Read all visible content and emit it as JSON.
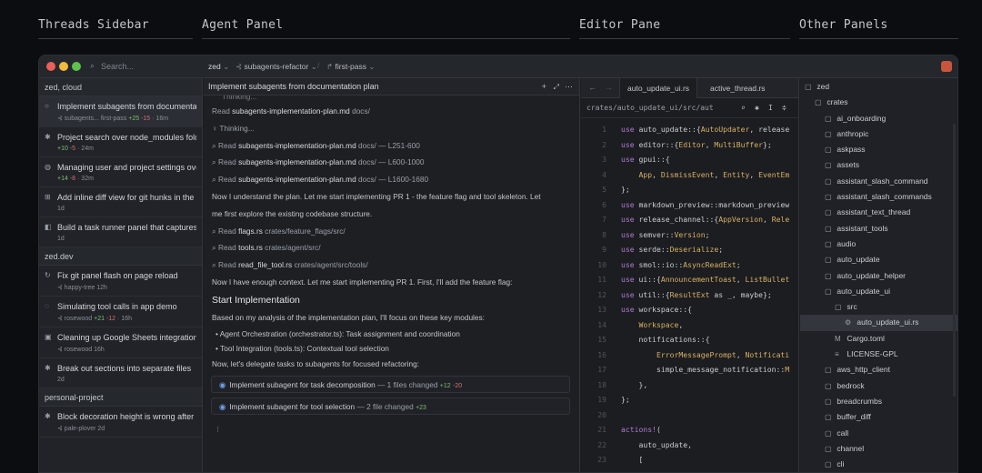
{
  "sections": [
    "Threads Sidebar",
    "Agent Panel",
    "Editor Pane",
    "Other Panels"
  ],
  "titlebar": {
    "search_placeholder": "Search...",
    "project": "zed",
    "branch": "subagents-refactor",
    "pass": "first-pass"
  },
  "sidebar": {
    "groups": [
      {
        "name": "zed, cloud",
        "threads": [
          {
            "icon": "○",
            "title": "Implement subagents from documentation plan",
            "meta": "⊰ subagents... first-pass",
            "plus": "+25",
            "minus": "-15",
            "age": "16m",
            "active": true
          },
          {
            "icon": "✱",
            "title": "Project search over node_modules folder",
            "meta": "",
            "plus": "+10",
            "minus": "-5",
            "age": "24m"
          },
          {
            "icon": "◍",
            "title": "Managing user and project settings overview",
            "meta": "",
            "plus": "+14",
            "minus": "-8",
            "age": "32m"
          },
          {
            "icon": "⊞",
            "title": "Add inline diff view for git hunks in the gutter",
            "meta": "",
            "plus": "",
            "minus": "",
            "age": "1d"
          },
          {
            "icon": "◧",
            "title": "Build a task runner panel that captures output",
            "meta": "",
            "plus": "",
            "minus": "",
            "age": "1d"
          }
        ]
      },
      {
        "name": "zed.dev",
        "threads": [
          {
            "icon": "↻",
            "title": "Fix git panel flash on page reload",
            "meta": "⊰ happy-tree",
            "plus": "",
            "minus": "",
            "age": "12h"
          },
          {
            "icon": "◌",
            "title": "Simulating tool calls in app demo",
            "meta": "⊰ rosewood",
            "plus": "+21",
            "minus": "-12",
            "age": "16h"
          },
          {
            "icon": "▣",
            "title": "Cleaning up Google Sheets integration",
            "meta": "⊰ rosewood",
            "plus": "",
            "minus": "",
            "age": "16h"
          },
          {
            "icon": "✱",
            "title": "Break out sections into separate files",
            "meta": "",
            "plus": "",
            "minus": "",
            "age": "2d"
          }
        ]
      },
      {
        "name": "personal-project",
        "threads": [
          {
            "icon": "✱",
            "title": "Block decoration height is wrong after resize",
            "meta": "⊰ pale-plover",
            "plus": "",
            "minus": "",
            "age": "2d"
          }
        ]
      }
    ]
  },
  "agent": {
    "title": "Implement subagents from documentation plan",
    "lines": [
      {
        "k": "cut",
        "text": "Thinking..."
      },
      {
        "k": "read",
        "pre": "Read",
        "file": "subagents-implementation-plan.md",
        "path": "docs/"
      },
      {
        "k": "think",
        "text": "Thinking..."
      },
      {
        "k": "read",
        "pre": "Read",
        "file": "subagents-implementation-plan.md",
        "path": "docs/ — L251-600",
        "search": true
      },
      {
        "k": "read",
        "pre": "Read",
        "file": "subagents-implementation-plan.md",
        "path": "docs/ — L600-1000",
        "search": true
      },
      {
        "k": "read",
        "pre": "Read",
        "file": "subagents-implementation-plan.md",
        "path": "docs/ — L1600-1680",
        "search": true
      },
      {
        "k": "p",
        "text": "Now I understand the plan. Let me start implementing PR 1 - the feature flag and tool skeleton. Let"
      },
      {
        "k": "p",
        "text": "me first explore the existing codebase structure."
      },
      {
        "k": "read",
        "pre": "Read",
        "file": "flags.rs",
        "path": "crates/feature_flags/src/",
        "search": true
      },
      {
        "k": "read",
        "pre": "Read",
        "file": "tools.rs",
        "path": "crates/agent/src/",
        "search": true
      },
      {
        "k": "read",
        "pre": "Read",
        "file": "read_file_tool.rs",
        "path": "crates/agent/src/tools/",
        "search": true
      },
      {
        "k": "p",
        "text": "Now I have enough context. Let me start implementing PR 1. First, I'll add the feature flag:"
      },
      {
        "k": "h",
        "text": "Start Implementation"
      },
      {
        "k": "p",
        "text": "Based on my analysis of the implementation plan, I'll focus on these key modules:"
      },
      {
        "k": "b",
        "text": "Agent Orchestration (orchestrator.ts): Task assignment and coordination"
      },
      {
        "k": "b",
        "text": "Tool Integration (tools.ts): Contextual tool selection"
      },
      {
        "k": "p",
        "text": "Now, let's delegate tasks to subagents for focused refactoring:"
      }
    ],
    "subagents": [
      {
        "text": "Implement subagent for task decomposition",
        "changes": "— 1 files changed",
        "plus": "+12",
        "minus": "-20"
      },
      {
        "text": "Implement subagent for tool selection",
        "changes": "— 2 file changed",
        "plus": "+23",
        "minus": ""
      }
    ]
  },
  "editor": {
    "tabs": [
      "auto_update_ui.rs",
      "active_thread.rs"
    ],
    "breadcrumb": "crates/auto_update_ui/src/aut",
    "code": [
      [
        [
          "kw",
          "use "
        ],
        [
          "pl",
          "auto_update::{"
        ],
        [
          "ty",
          "AutoUpdater"
        ],
        [
          "pl",
          ", release"
        ]
      ],
      [
        [
          "kw",
          "use "
        ],
        [
          "pl",
          "editor::{"
        ],
        [
          "ty",
          "Editor"
        ],
        [
          "pl",
          ", "
        ],
        [
          "ty",
          "MultiBuffer"
        ],
        [
          "pl",
          "};"
        ]
      ],
      [
        [
          "kw",
          "use "
        ],
        [
          "pl",
          "gpui::{"
        ]
      ],
      [
        [
          "pl",
          "    "
        ],
        [
          "ty",
          "App"
        ],
        [
          "pl",
          ", "
        ],
        [
          "ty",
          "DismissEvent"
        ],
        [
          "pl",
          ", "
        ],
        [
          "ty",
          "Entity"
        ],
        [
          "pl",
          ", "
        ],
        [
          "ty",
          "EventEm"
        ]
      ],
      [
        [
          "pl",
          "};"
        ]
      ],
      [
        [
          "kw",
          "use "
        ],
        [
          "pl",
          "markdown_preview::markdown_preview"
        ]
      ],
      [
        [
          "kw",
          "use "
        ],
        [
          "pl",
          "release_channel::{"
        ],
        [
          "ty",
          "AppVersion"
        ],
        [
          "pl",
          ", "
        ],
        [
          "ty",
          "Rele"
        ]
      ],
      [
        [
          "kw",
          "use "
        ],
        [
          "pl",
          "semver::"
        ],
        [
          "ty",
          "Version"
        ],
        [
          "pl",
          ";"
        ]
      ],
      [
        [
          "kw",
          "use "
        ],
        [
          "pl",
          "serde::"
        ],
        [
          "ty",
          "Deserialize"
        ],
        [
          "pl",
          ";"
        ]
      ],
      [
        [
          "kw",
          "use "
        ],
        [
          "pl",
          "smol::io::"
        ],
        [
          "ty",
          "AsyncReadExt"
        ],
        [
          "pl",
          ";"
        ]
      ],
      [
        [
          "kw",
          "use "
        ],
        [
          "pl",
          "ui::{"
        ],
        [
          "ty",
          "AnnouncementToast"
        ],
        [
          "pl",
          ", "
        ],
        [
          "ty",
          "ListBullet"
        ]
      ],
      [
        [
          "kw",
          "use "
        ],
        [
          "pl",
          "util::{"
        ],
        [
          "ty",
          "ResultExt"
        ],
        [
          "pl",
          " as _, maybe};"
        ]
      ],
      [
        [
          "kw",
          "use "
        ],
        [
          "pl",
          "workspace::{"
        ]
      ],
      [
        [
          "pl",
          "    "
        ],
        [
          "ty",
          "Workspace"
        ],
        [
          "pl",
          ","
        ]
      ],
      [
        [
          "pl",
          "    notifications::{"
        ]
      ],
      [
        [
          "pl",
          "        "
        ],
        [
          "ty",
          "ErrorMessagePrompt"
        ],
        [
          "pl",
          ", "
        ],
        [
          "ty",
          "Notificati"
        ]
      ],
      [
        [
          "pl",
          "        simple_message_notification::"
        ],
        [
          "ty",
          "M"
        ]
      ],
      [
        [
          "pl",
          "    },"
        ]
      ],
      [
        [
          "pl",
          "};"
        ]
      ],
      [
        [
          "pl",
          ""
        ]
      ],
      [
        [
          "kw",
          "actions!"
        ],
        [
          "pl",
          "("
        ]
      ],
      [
        [
          "pl",
          "    auto_update,"
        ]
      ],
      [
        [
          "pl",
          "    ["
        ]
      ],
      [
        [
          "cm",
          "        /// Opens the release notes fo"
        ]
      ]
    ]
  },
  "tree": [
    {
      "d": 0,
      "g": "▢",
      "n": "zed"
    },
    {
      "d": 1,
      "g": "▢",
      "n": "crates"
    },
    {
      "d": 2,
      "g": "▢",
      "n": "ai_onboarding"
    },
    {
      "d": 2,
      "g": "▢",
      "n": "anthropic"
    },
    {
      "d": 2,
      "g": "▢",
      "n": "askpass"
    },
    {
      "d": 2,
      "g": "▢",
      "n": "assets"
    },
    {
      "d": 2,
      "g": "▢",
      "n": "assistant_slash_command"
    },
    {
      "d": 2,
      "g": "▢",
      "n": "assistant_slash_commands"
    },
    {
      "d": 2,
      "g": "▢",
      "n": "assistant_text_thread"
    },
    {
      "d": 2,
      "g": "▢",
      "n": "assistant_tools"
    },
    {
      "d": 2,
      "g": "▢",
      "n": "audio"
    },
    {
      "d": 2,
      "g": "▢",
      "n": "auto_update"
    },
    {
      "d": 2,
      "g": "▢",
      "n": "auto_update_helper"
    },
    {
      "d": 2,
      "g": "▢",
      "n": "auto_update_ui"
    },
    {
      "d": 3,
      "g": "▢",
      "n": "src"
    },
    {
      "d": 4,
      "g": "⚙",
      "n": "auto_update_ui.rs",
      "sel": true
    },
    {
      "d": 3,
      "g": "M",
      "n": "Cargo.toml"
    },
    {
      "d": 3,
      "g": "≡",
      "n": "LICENSE-GPL"
    },
    {
      "d": 2,
      "g": "▢",
      "n": "aws_http_client"
    },
    {
      "d": 2,
      "g": "▢",
      "n": "bedrock"
    },
    {
      "d": 2,
      "g": "▢",
      "n": "breadcrumbs"
    },
    {
      "d": 2,
      "g": "▢",
      "n": "buffer_diff"
    },
    {
      "d": 2,
      "g": "▢",
      "n": "call"
    },
    {
      "d": 2,
      "g": "▢",
      "n": "channel"
    },
    {
      "d": 2,
      "g": "▢",
      "n": "cli"
    }
  ]
}
